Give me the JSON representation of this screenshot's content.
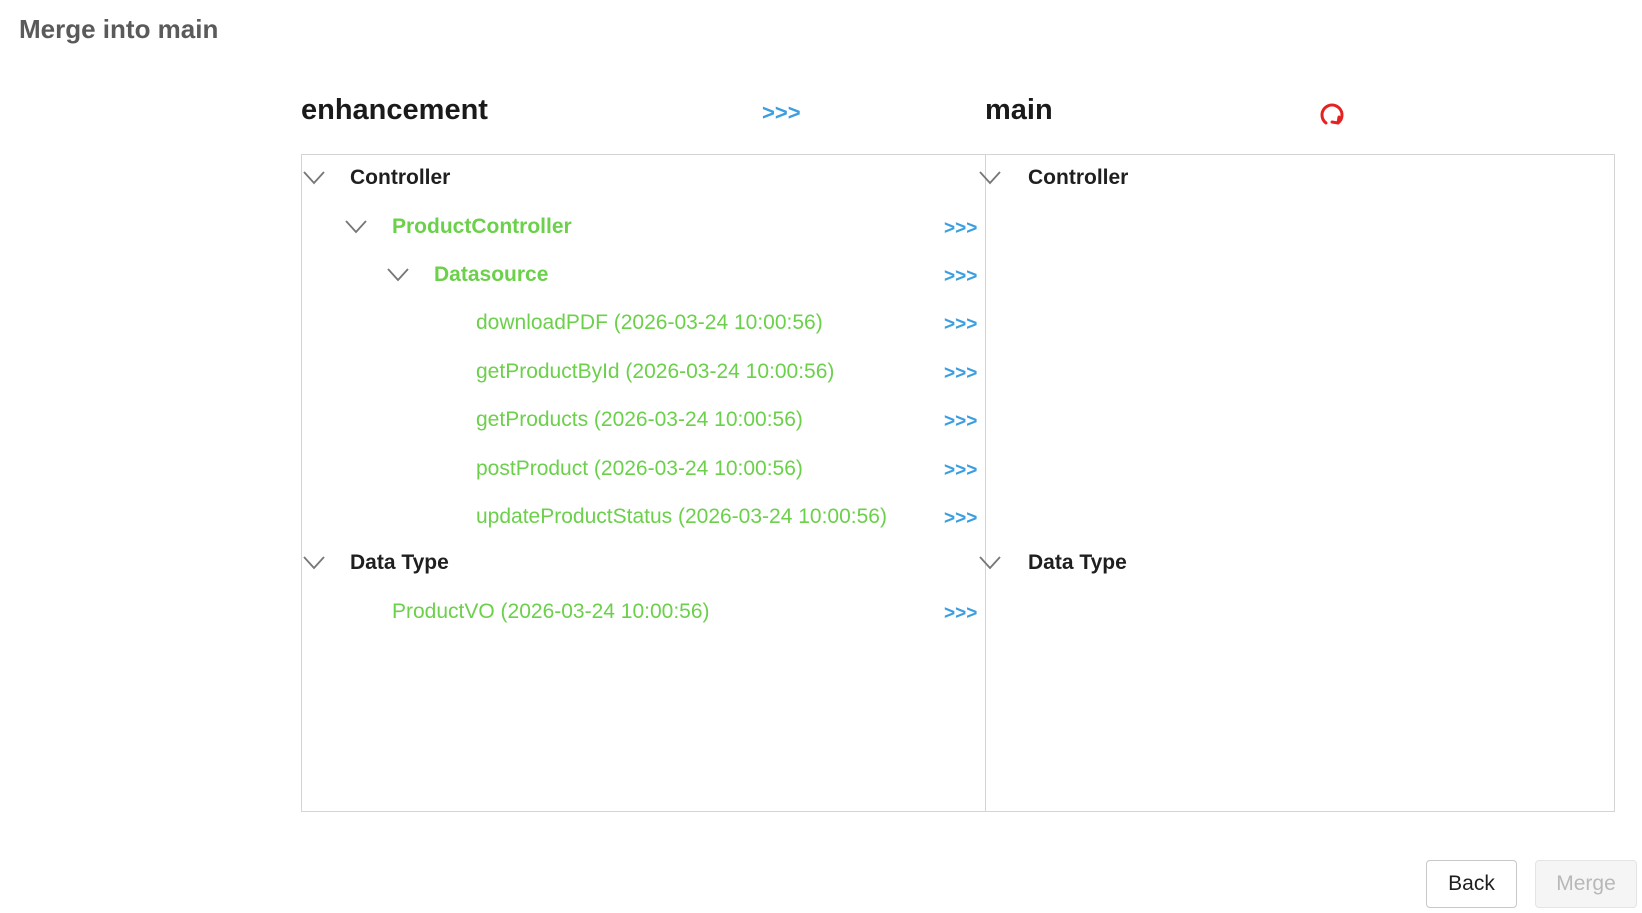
{
  "page": {
    "title": "Merge into main"
  },
  "header": {
    "source_branch": "enhancement",
    "merge_all_arrows": ">>>",
    "target_branch": "main",
    "refresh_icon": "refresh-icon"
  },
  "colors": {
    "accent_blue": "#3a9ee0",
    "new_item_green": "#6bd04a",
    "refresh_red": "#e52222"
  },
  "left_tree": [
    {
      "label": "Controller",
      "level": 0,
      "expandable": true,
      "style": "dark",
      "arrow": ""
    },
    {
      "label": "ProductController",
      "level": 1,
      "expandable": true,
      "style": "green-bold",
      "arrow": ">>>"
    },
    {
      "label": "Datasource",
      "level": 2,
      "expandable": true,
      "style": "green-bold",
      "arrow": ">>>"
    },
    {
      "label": "downloadPDF (2026-03-24 10:00:56)",
      "level": 3,
      "expandable": false,
      "style": "green",
      "arrow": ">>>"
    },
    {
      "label": "getProductById (2026-03-24 10:00:56)",
      "level": 3,
      "expandable": false,
      "style": "green",
      "arrow": ">>>"
    },
    {
      "label": "getProducts (2026-03-24 10:00:56)",
      "level": 3,
      "expandable": false,
      "style": "green",
      "arrow": ">>>"
    },
    {
      "label": "postProduct (2026-03-24 10:00:56)",
      "level": 3,
      "expandable": false,
      "style": "green",
      "arrow": ">>>"
    },
    {
      "label": "updateProductStatus (2026-03-24 10:00:56)",
      "level": 3,
      "expandable": false,
      "style": "green",
      "arrow": ">>>"
    },
    {
      "label": "Data Type",
      "level": 0,
      "expandable": true,
      "style": "dark",
      "arrow": ""
    },
    {
      "label": "ProductVO (2026-03-24 10:00:56)",
      "level": 1,
      "expandable": false,
      "style": "green",
      "arrow": ">>>"
    }
  ],
  "right_tree": {
    "controller_label": "Controller",
    "data_type_label": "Data Type"
  },
  "footer": {
    "back_label": "Back",
    "merge_label": "Merge",
    "merge_enabled": false
  }
}
